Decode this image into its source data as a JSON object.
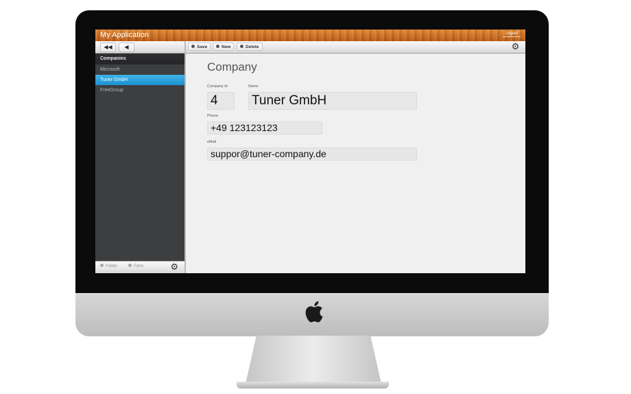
{
  "app": {
    "title": "My Application",
    "logout_label": "Logout"
  },
  "sidebar": {
    "nav": {
      "first_label": "◀◀",
      "prev_label": "◀"
    },
    "header": "Companies",
    "items": [
      {
        "label": "Microsoft",
        "active": false
      },
      {
        "label": "Tuner GmbH",
        "active": true
      },
      {
        "label": "FreeGroup",
        "active": false
      }
    ],
    "footer": {
      "folder_label": "Folder",
      "form_label": "Form",
      "gear_icon": "gear-icon"
    }
  },
  "toolbar": {
    "save_label": "Save",
    "new_label": "New",
    "delete_label": "Delete",
    "gear_icon": "gear-icon"
  },
  "form": {
    "title": "Company",
    "company_id": {
      "label": "Company Id",
      "value": "4"
    },
    "name": {
      "label": "Name",
      "value": "Tuner GmbH"
    },
    "phone": {
      "label": "Phone",
      "value": "+49 123123123"
    },
    "email": {
      "label": "eMail",
      "value": "suppor@tuner-company.de"
    }
  },
  "colors": {
    "titlebar": "#c96a1f",
    "selection": "#2a9fdc",
    "sidebar": "#3a3b3d"
  }
}
